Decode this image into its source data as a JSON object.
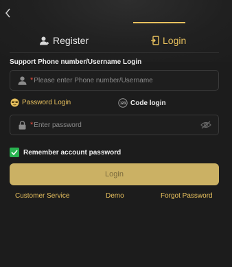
{
  "tabs": {
    "register_label": "Register",
    "login_label": "Login"
  },
  "login_hint": "Support Phone number/Username Login",
  "phone_field": {
    "required_mark": "*",
    "placeholder": "Please enter Phone number/Username"
  },
  "login_modes": {
    "password_label": "Password Login",
    "code_label": "Code login",
    "code_icon_text": "123"
  },
  "password_field": {
    "required_mark": "*",
    "placeholder": "Enter password"
  },
  "remember": {
    "label": "Remember account password",
    "checked": true
  },
  "submit_label": "Login",
  "footer_links": {
    "customer_service": "Customer Service",
    "demo": "Demo",
    "forgot_password": "Forgot Password"
  },
  "colors": {
    "accent": "#e8c15e",
    "button": "#cbb164",
    "check": "#29b350",
    "required": "#e84c3d",
    "background": "#1c1c1c"
  },
  "icons": {
    "back": "chevron-left-icon",
    "register": "user-plus-icon",
    "login": "door-enter-icon",
    "user": "user-icon",
    "password_mode": "sunglasses-face-icon",
    "code_mode": "123-circle-icon",
    "lock": "lock-icon",
    "eye": "eye-off-icon",
    "check": "check-icon"
  }
}
